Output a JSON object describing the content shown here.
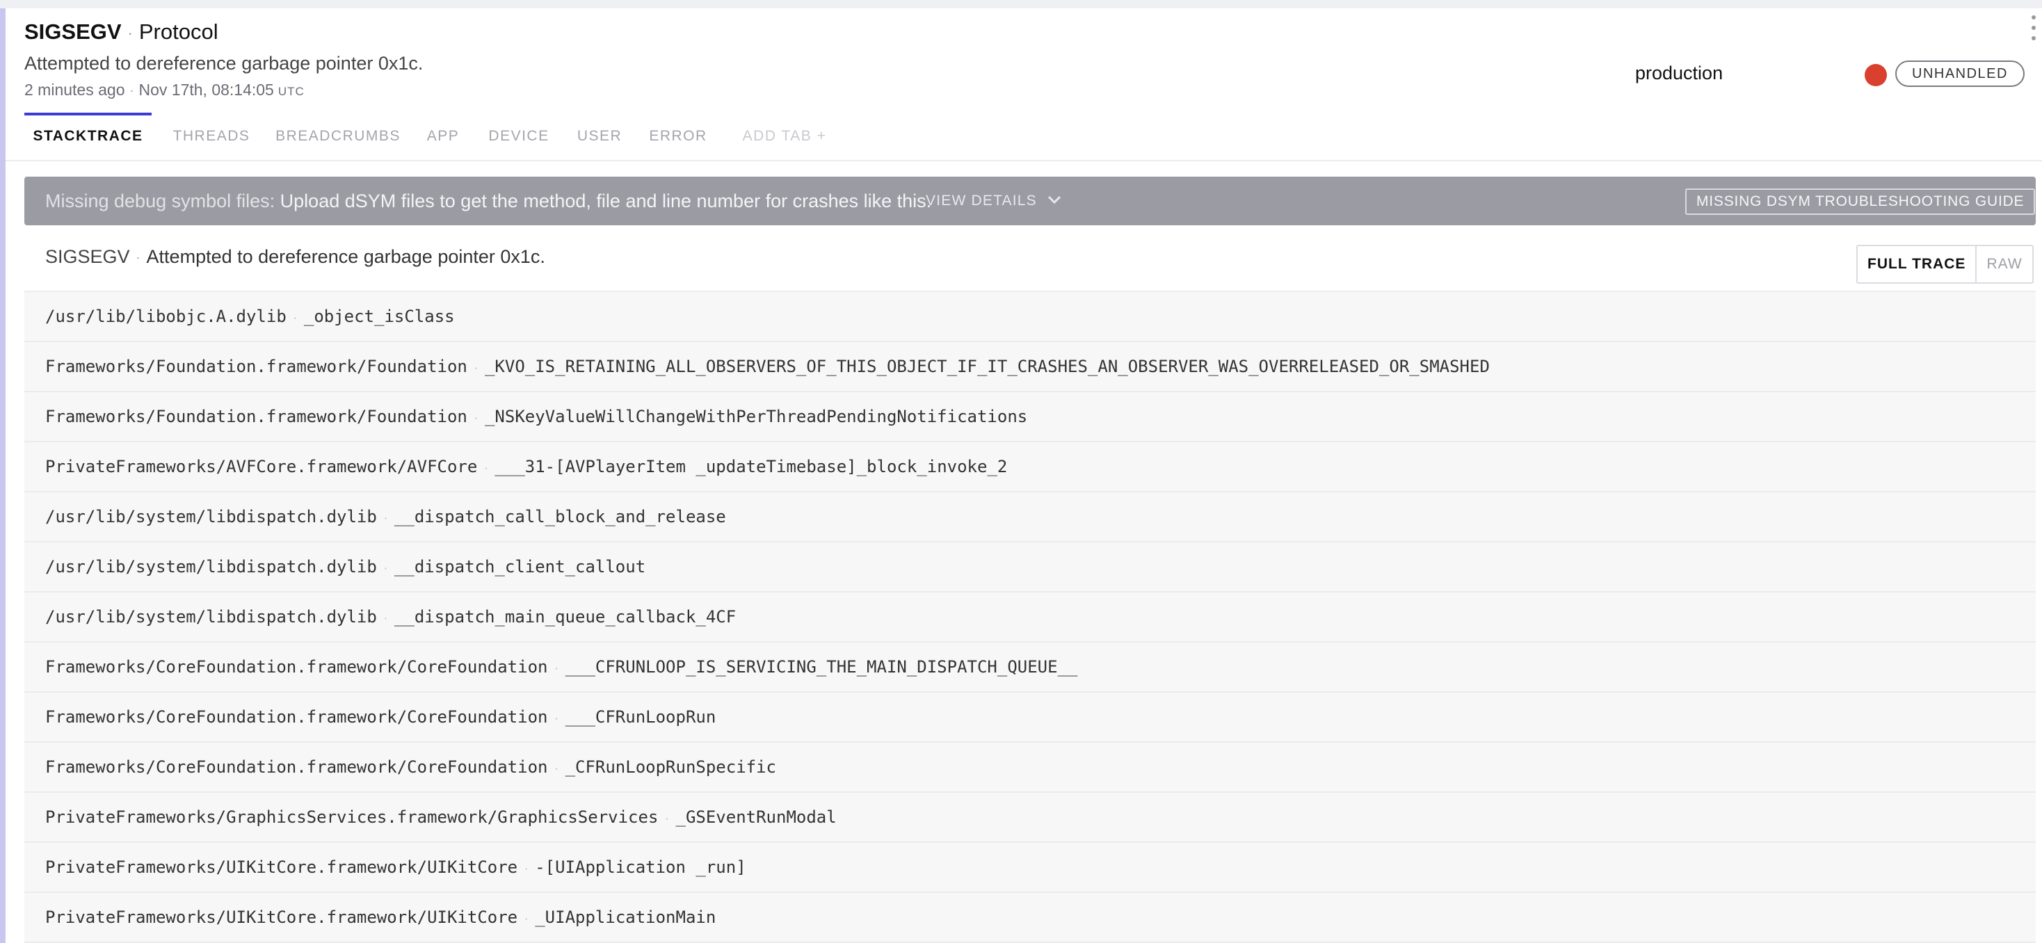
{
  "header": {
    "error_class": "SIGSEGV",
    "separator": "·",
    "context": "Protocol",
    "message": "Attempted to dereference garbage pointer 0x1c.",
    "relative_time": "2 minutes ago",
    "timestamp": "Nov 17th, 08:14:05",
    "timezone": "UTC",
    "environment": "production",
    "severity_color": "#d9402e",
    "handled_state": "UNHANDLED"
  },
  "tabs": [
    {
      "label": "STACKTRACE",
      "active": true
    },
    {
      "label": "THREADS"
    },
    {
      "label": "BREADCRUMBS"
    },
    {
      "label": "APP"
    },
    {
      "label": "DEVICE"
    },
    {
      "label": "USER"
    },
    {
      "label": "ERROR"
    },
    {
      "label": "ADD TAB +"
    }
  ],
  "notice": {
    "lead": "Missing debug symbol files:",
    "text": "Upload dSYM files to get the method, file and line number for crashes like this.",
    "view_details": "VIEW DETAILS",
    "guide_button": "MISSING DSYM TROUBLESHOOTING GUIDE"
  },
  "trace": {
    "error_class": "SIGSEGV",
    "message": "Attempted to dereference garbage pointer 0x1c.",
    "full_trace_label": "FULL TRACE",
    "raw_label": "RAW"
  },
  "frames": [
    {
      "file": "/usr/lib/libobjc.A.dylib",
      "method": "_object_isClass"
    },
    {
      "file": "Frameworks/Foundation.framework/Foundation",
      "method": "_KVO_IS_RETAINING_ALL_OBSERVERS_OF_THIS_OBJECT_IF_IT_CRASHES_AN_OBSERVER_WAS_OVERRELEASED_OR_SMASHED"
    },
    {
      "file": "Frameworks/Foundation.framework/Foundation",
      "method": "_NSKeyValueWillChangeWithPerThreadPendingNotifications"
    },
    {
      "file": "PrivateFrameworks/AVFCore.framework/AVFCore",
      "method": "___31-[AVPlayerItem _updateTimebase]_block_invoke_2"
    },
    {
      "file": "/usr/lib/system/libdispatch.dylib",
      "method": "__dispatch_call_block_and_release"
    },
    {
      "file": "/usr/lib/system/libdispatch.dylib",
      "method": "__dispatch_client_callout"
    },
    {
      "file": "/usr/lib/system/libdispatch.dylib",
      "method": "__dispatch_main_queue_callback_4CF"
    },
    {
      "file": "Frameworks/CoreFoundation.framework/CoreFoundation",
      "method": "___CFRUNLOOP_IS_SERVICING_THE_MAIN_DISPATCH_QUEUE__"
    },
    {
      "file": "Frameworks/CoreFoundation.framework/CoreFoundation",
      "method": "___CFRunLoopRun"
    },
    {
      "file": "Frameworks/CoreFoundation.framework/CoreFoundation",
      "method": "_CFRunLoopRunSpecific"
    },
    {
      "file": "PrivateFrameworks/GraphicsServices.framework/GraphicsServices",
      "method": "_GSEventRunModal"
    },
    {
      "file": "PrivateFrameworks/UIKitCore.framework/UIKitCore",
      "method": "-[UIApplication _run]"
    },
    {
      "file": "PrivateFrameworks/UIKitCore.framework/UIKitCore",
      "method": "_UIApplicationMain"
    }
  ]
}
